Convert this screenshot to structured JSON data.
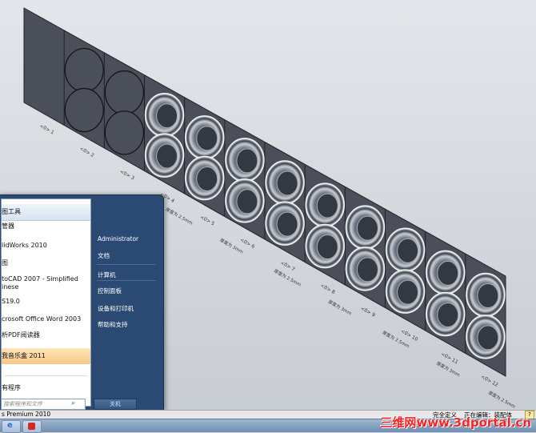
{
  "viewport": {
    "part_labels": [
      "<0> 1",
      "<0> 2",
      "<0> 3",
      "<0> 4",
      "<0> 5",
      "<0> 6",
      "<0> 7",
      "<0> 8",
      "<0> 9",
      "<0> 10",
      "<0> 11",
      "<0> 12"
    ],
    "fringe_notes": [
      "厚度为 2.5mm",
      "厚度为 3mm",
      "厚度为 2.5mm",
      "厚度为 3mm",
      "厚度为 2.5mm",
      "厚度为 3mm",
      "厚度为 2.5mm"
    ]
  },
  "start_menu": {
    "programs": [
      {
        "label": "图工具",
        "pinned": true
      },
      {
        "label": "管器"
      },
      {
        "label": "lidWorks 2010"
      },
      {
        "label": "图"
      },
      {
        "label": "toCAD 2007 - Simplified"
      },
      {
        "label": "inese"
      },
      {
        "label": "S19.0"
      },
      {
        "label": "crosoft Office Word 2003"
      },
      {
        "label": "析PDF阅读器"
      },
      {
        "label": "我音乐盒 2011",
        "highlight": true
      },
      {
        "label": "有程序"
      }
    ],
    "search_placeholder": "搜索程序和文件",
    "right_items": [
      "Administrator",
      "文档",
      "计算机",
      "控制面板",
      "设备和打印机",
      "帮助和支持"
    ],
    "shutdown_label": "关机"
  },
  "status": {
    "left_text": "s Premium 2010",
    "state_text": "完全定义",
    "mode_text": "正在编辑：装配体",
    "help_badge": "?"
  },
  "watermark": {
    "text": "三维网www.3dportal.cn"
  },
  "colors": {
    "panel_fill": "#4a4f5a",
    "panel_stroke": "#1e2128",
    "start_menu_bg": "#2b4a73",
    "watermark": "#ff2020"
  }
}
